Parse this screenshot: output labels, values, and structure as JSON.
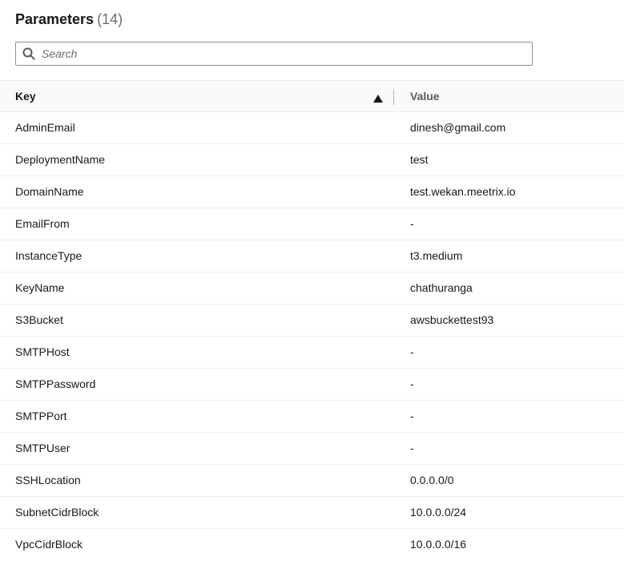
{
  "header": {
    "title": "Parameters",
    "count": "(14)"
  },
  "search": {
    "placeholder": "Search",
    "value": "",
    "icon": "search-icon"
  },
  "table": {
    "columns": [
      {
        "label": "Key",
        "sort": "ascending"
      },
      {
        "label": "Value"
      }
    ],
    "rows": [
      {
        "key": "AdminEmail",
        "value": "dinesh@gmail.com"
      },
      {
        "key": "DeploymentName",
        "value": "test"
      },
      {
        "key": "DomainName",
        "value": "test.wekan.meetrix.io"
      },
      {
        "key": "EmailFrom",
        "value": "-"
      },
      {
        "key": "InstanceType",
        "value": "t3.medium"
      },
      {
        "key": "KeyName",
        "value": "chathuranga"
      },
      {
        "key": "S3Bucket",
        "value": "awsbuckettest93"
      },
      {
        "key": "SMTPHost",
        "value": "-"
      },
      {
        "key": "SMTPPassword",
        "value": "-"
      },
      {
        "key": "SMTPPort",
        "value": "-"
      },
      {
        "key": "SMTPUser",
        "value": "-"
      },
      {
        "key": "SSHLocation",
        "value": "0.0.0.0/0"
      },
      {
        "key": "SubnetCidrBlock",
        "value": "10.0.0.0/24"
      },
      {
        "key": "VpcCidrBlock",
        "value": "10.0.0.0/16"
      }
    ]
  },
  "colors": {
    "text": "#16191f",
    "muted": "#687078",
    "border": "#eaeded",
    "header_bg": "#fafafa",
    "input_border": "#879596"
  }
}
